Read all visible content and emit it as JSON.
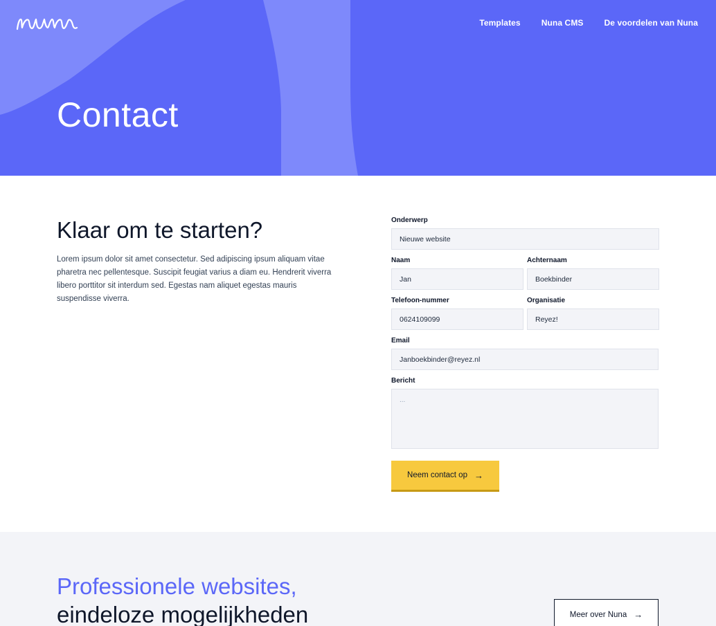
{
  "brand": {
    "logo_text": "nuna"
  },
  "nav": {
    "items": [
      {
        "label": "Templates"
      },
      {
        "label": "Nuna CMS"
      },
      {
        "label": "De voordelen van Nuna"
      }
    ]
  },
  "hero": {
    "title": "Contact"
  },
  "intro": {
    "heading": "Klaar om te starten?",
    "body": "Lorem ipsum dolor sit amet consectetur. Sed adipiscing ipsum aliquam vitae pharetra nec pellentesque. Suscipit feugiat varius a diam eu. Hendrerit viverra libero porttitor sit interdum sed. Egestas nam aliquet egestas mauris suspendisse viverra."
  },
  "form": {
    "subject": {
      "label": "Onderwerp",
      "value": "Nieuwe website"
    },
    "first_name": {
      "label": "Naam",
      "value": "Jan"
    },
    "last_name": {
      "label": "Achternaam",
      "value": "Boekbinder"
    },
    "phone": {
      "label": "Telefoon-nummer",
      "value": "0624109099"
    },
    "organisation": {
      "label": "Organisatie",
      "value": "Reyez!"
    },
    "email": {
      "label": "Email",
      "value": "Janboekbinder@reyez.nl"
    },
    "message": {
      "label": "Bericht",
      "value": "..."
    },
    "submit_label": "Neem contact op",
    "submit_icon": "arrow-right-icon"
  },
  "cta": {
    "line1": "Professionele websites,",
    "line2": "eindeloze mogelijkheden",
    "button_label": "Meer over Nuna",
    "button_icon": "arrow-right-icon"
  },
  "colors": {
    "primary": "#5b67f8",
    "accent": "#f7c93e",
    "text": "#0f172a"
  }
}
